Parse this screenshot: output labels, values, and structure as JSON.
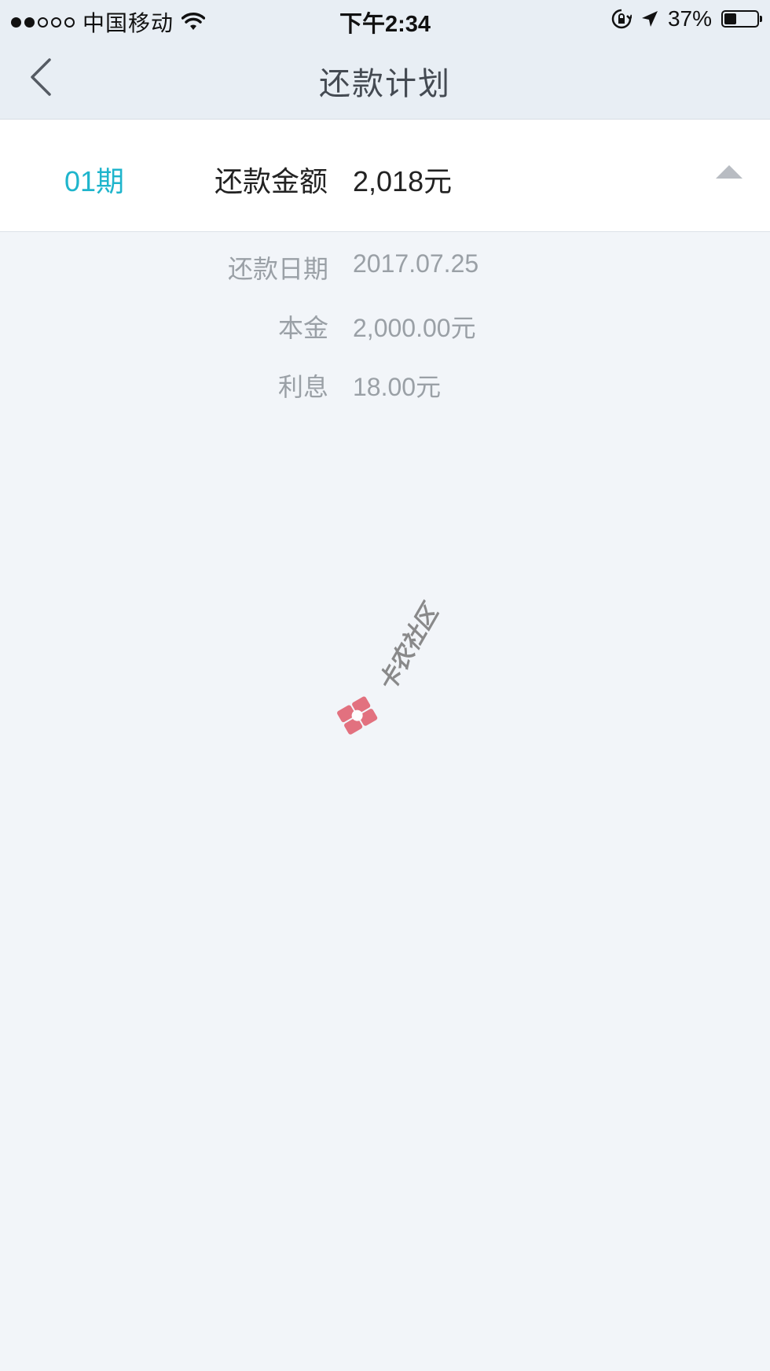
{
  "status_bar": {
    "carrier": "中国移动",
    "time": "下午2:34",
    "battery_pct_text": "37%",
    "battery_level": 0.37,
    "signal_bars_filled": 2,
    "signal_bars_total": 5,
    "icons": [
      "wifi-icon",
      "orientation-lock-icon",
      "location-arrow-icon",
      "battery-icon"
    ]
  },
  "nav": {
    "title": "还款计划",
    "back_icon": "chevron-left-icon"
  },
  "plan": {
    "period": "01期",
    "amount_label": "还款金额",
    "amount_value": "2,018元",
    "expanded": true,
    "details": [
      {
        "label": "还款日期",
        "value": "2017.07.25"
      },
      {
        "label": "本金",
        "value": "2,000.00元"
      },
      {
        "label": "利息",
        "value": "18.00元"
      }
    ]
  },
  "watermark": {
    "text": "卡农社区"
  },
  "colors": {
    "accent": "#1fb5cc",
    "header_bg": "#e8eef4",
    "page_bg": "#f2f5f9",
    "muted_text": "#9aa0a6",
    "primary_text": "#222222"
  }
}
